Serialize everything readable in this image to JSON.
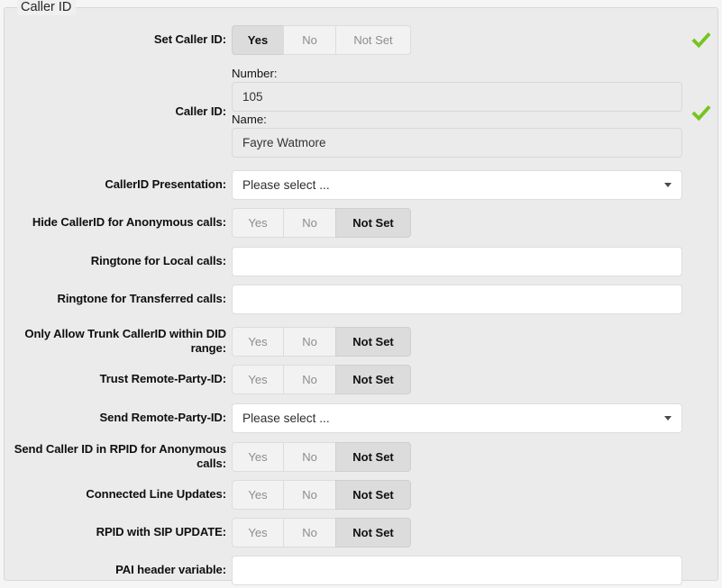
{
  "fieldset": {
    "legend": "Caller ID"
  },
  "colors": {
    "panel_bg": "#ebebeb",
    "page_bg": "#f5f5f5",
    "check_green": "#76c422",
    "active_btn_bg": "#dcdcdc",
    "inactive_btn_text": "#8d8d8d"
  },
  "toggle_options": {
    "yes": "Yes",
    "no": "No",
    "not_set": "Not Set"
  },
  "select_placeholder": "Please select ...",
  "rows": [
    {
      "id": "set-caller-id",
      "label": "Set Caller ID:",
      "type": "toggle",
      "selected": "Yes",
      "has_check": true
    },
    {
      "id": "caller-id",
      "label": "Caller ID:",
      "type": "caller-id",
      "number_label": "Number:",
      "number_value": "105",
      "name_label": "Name:",
      "name_value": "Fayre Watmore",
      "has_check": true
    },
    {
      "id": "callerid-presentation",
      "label": "CallerID Presentation:",
      "type": "select",
      "value": "Please select ...",
      "has_check": false
    },
    {
      "id": "hide-callerid-anonymous",
      "label": "Hide CallerID for Anonymous calls:",
      "type": "toggle",
      "selected": "Not Set",
      "has_check": false
    },
    {
      "id": "ringtone-local",
      "label": "Ringtone for Local calls:",
      "type": "text",
      "value": "",
      "placeholder": "",
      "has_check": false
    },
    {
      "id": "ringtone-transferred",
      "label": "Ringtone for Transferred calls:",
      "type": "text",
      "value": "",
      "placeholder": "",
      "has_check": false
    },
    {
      "id": "only-allow-trunk-callerid-did",
      "label": "Only Allow Trunk CallerID within DID range:",
      "type": "toggle",
      "selected": "Not Set",
      "has_check": false
    },
    {
      "id": "trust-remote-party-id",
      "label": "Trust Remote-Party-ID:",
      "type": "toggle",
      "selected": "Not Set",
      "has_check": false
    },
    {
      "id": "send-remote-party-id",
      "label": "Send Remote-Party-ID:",
      "type": "select",
      "value": "Please select ...",
      "has_check": false
    },
    {
      "id": "send-caller-id-rpid-anonymous",
      "label": "Send Caller ID in RPID for Anonymous calls:",
      "type": "toggle",
      "selected": "Not Set",
      "has_check": false
    },
    {
      "id": "connected-line-updates",
      "label": "Connected Line Updates:",
      "type": "toggle",
      "selected": "Not Set",
      "has_check": false
    },
    {
      "id": "rpid-with-sip-update",
      "label": "RPID with SIP UPDATE:",
      "type": "toggle",
      "selected": "Not Set",
      "has_check": false
    },
    {
      "id": "pai-header-variable",
      "label": "PAI header variable:",
      "type": "text",
      "value": "",
      "placeholder": "",
      "has_check": false
    }
  ]
}
